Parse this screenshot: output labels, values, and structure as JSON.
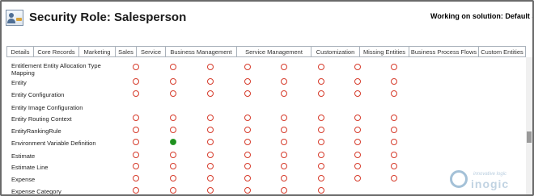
{
  "header": {
    "title": "Security Role: Salesperson",
    "working_on": "Working on solution: Default Solution"
  },
  "tabs": [
    {
      "label": "Details"
    },
    {
      "label": "Core Records"
    },
    {
      "label": "Marketing"
    },
    {
      "label": "Sales"
    },
    {
      "label": "Service"
    },
    {
      "label": "Business Management"
    },
    {
      "label": "Service Management"
    },
    {
      "label": "Customization"
    },
    {
      "label": "Missing Entities"
    },
    {
      "label": "Business Process Flows"
    },
    {
      "label": "Custom Entities",
      "active": true
    }
  ],
  "rows": [
    {
      "label": "Entitlement Entity Allocation Type",
      "label2": "Mapping",
      "privileges": [
        "none",
        "none",
        "none",
        "none",
        "none",
        "none",
        "none",
        "none"
      ]
    },
    {
      "label": "Entity",
      "privileges": [
        "none",
        "none",
        "none",
        "none",
        "none",
        "none",
        "none",
        "none"
      ]
    },
    {
      "label": "Entity Configuration",
      "privileges": [
        "none",
        "none",
        "none",
        "none",
        "none",
        "none",
        "none",
        "none"
      ]
    },
    {
      "label": "Entity Image Configuration",
      "privileges": []
    },
    {
      "label": "Entity Routing Context",
      "privileges": [
        "none",
        "none",
        "none",
        "none",
        "none",
        "none",
        "none",
        "none"
      ]
    },
    {
      "label": "EntityRankingRule",
      "privileges": [
        "none",
        "none",
        "none",
        "none",
        "none",
        "none",
        "none",
        "none"
      ]
    },
    {
      "label": "Environment Variable Definition",
      "privileges": [
        "none",
        "granted",
        "none",
        "none",
        "none",
        "none",
        "none",
        "none"
      ]
    },
    {
      "label": "Estimate",
      "privileges": [
        "none",
        "none",
        "none",
        "none",
        "none",
        "none",
        "none",
        "none"
      ]
    },
    {
      "label": "Estimate Line",
      "privileges": [
        "none",
        "none",
        "none",
        "none",
        "none",
        "none",
        "none",
        "none"
      ]
    },
    {
      "label": "Expense",
      "privileges": [
        "none",
        "none",
        "none",
        "none",
        "none",
        "none",
        "none",
        "none"
      ]
    },
    {
      "label": "Expense Category",
      "privileges": [
        "none",
        "none",
        "none",
        "none",
        "none",
        "none"
      ]
    }
  ],
  "watermark": {
    "tagline": "innovative logic",
    "brand": "inogic"
  },
  "colors": {
    "privilege_none": "#d63b2b",
    "privilege_granted": "#1f8f1f"
  },
  "icons": {
    "role": "security-role-icon",
    "brand": "inogic-logo-icon"
  }
}
